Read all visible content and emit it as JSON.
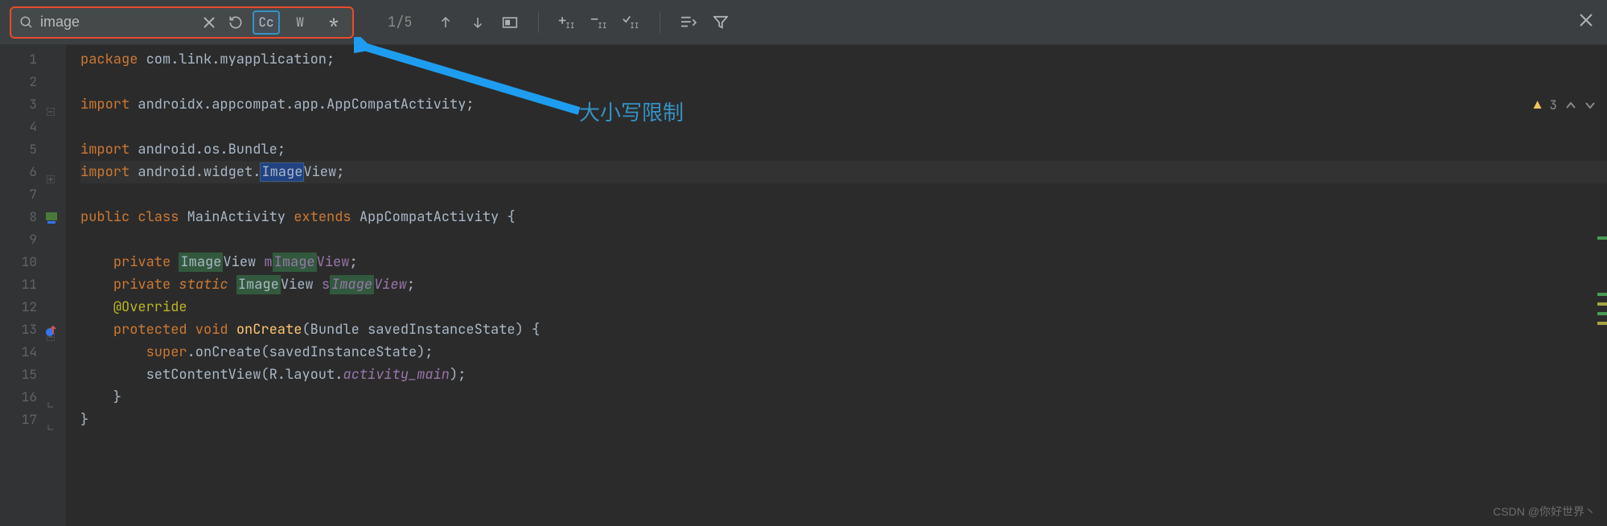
{
  "search": {
    "value": "image",
    "match_case_label": "Cc",
    "words_label": "W",
    "regex_char": "*",
    "result_count": "1/5"
  },
  "status": {
    "warning_count": "3"
  },
  "annotation": {
    "label": "大小写限制"
  },
  "watermark": "CSDN @你好世界丶",
  "code": {
    "lines": [
      {
        "n": "1",
        "tokens": [
          [
            "kw",
            "package "
          ],
          [
            "type",
            "com.link.myapplication"
          ],
          [
            "type",
            ";"
          ]
        ]
      },
      {
        "n": "2",
        "tokens": []
      },
      {
        "n": "3",
        "tokens": [
          [
            "kw",
            "import "
          ],
          [
            "type",
            "androidx.appcompat.app.AppCompatActivity"
          ],
          [
            "type",
            ";"
          ]
        ],
        "fold": "minus"
      },
      {
        "n": "4",
        "tokens": []
      },
      {
        "n": "5",
        "tokens": [
          [
            "kw",
            "import "
          ],
          [
            "type",
            "android.os.Bundle"
          ],
          [
            "type",
            ";"
          ]
        ]
      },
      {
        "n": "6",
        "tokens": [
          [
            "kw",
            "import "
          ],
          [
            "type",
            "android.widget."
          ],
          [
            "hlcur",
            "Image"
          ],
          [
            "type",
            "View"
          ],
          [
            "type",
            ";"
          ]
        ],
        "fold": "plus",
        "current": true
      },
      {
        "n": "7",
        "tokens": []
      },
      {
        "n": "8",
        "tokens": [
          [
            "kw",
            "public class "
          ],
          [
            "type",
            "MainActivity "
          ],
          [
            "kw",
            "extends "
          ],
          [
            "type",
            "AppCompatActivity {"
          ]
        ],
        "marker": "class"
      },
      {
        "n": "9",
        "tokens": []
      },
      {
        "n": "10",
        "tokens": [
          [
            "type",
            "    "
          ],
          [
            "kw",
            "private "
          ],
          [
            "hl",
            "Image"
          ],
          [
            "type",
            "View "
          ],
          [
            "field",
            "m"
          ],
          [
            "hlf",
            "Image"
          ],
          [
            "field",
            "View"
          ],
          [
            "type",
            ";"
          ]
        ]
      },
      {
        "n": "11",
        "tokens": [
          [
            "type",
            "    "
          ],
          [
            "kw",
            "private "
          ],
          [
            "kws",
            "static"
          ],
          [
            "type",
            " "
          ],
          [
            "hl",
            "Image"
          ],
          [
            "type",
            "View "
          ],
          [
            "field",
            "s"
          ],
          [
            "hlfi",
            "Image"
          ],
          [
            "fieldI",
            "View"
          ],
          [
            "type",
            ";"
          ]
        ]
      },
      {
        "n": "12",
        "tokens": [
          [
            "type",
            "    "
          ],
          [
            "note",
            "@Override"
          ]
        ]
      },
      {
        "n": "13",
        "tokens": [
          [
            "type",
            "    "
          ],
          [
            "kw",
            "protected void "
          ],
          [
            "fn",
            "onCreate"
          ],
          [
            "type",
            "(Bundle savedInstanceState) {"
          ]
        ],
        "fold": "minus",
        "marker": "override"
      },
      {
        "n": "14",
        "tokens": [
          [
            "type",
            "        "
          ],
          [
            "kw",
            "super"
          ],
          [
            "type",
            ".onCreate(savedInstanceState);"
          ]
        ]
      },
      {
        "n": "15",
        "tokens": [
          [
            "type",
            "        setContentView(R.layout."
          ],
          [
            "prop",
            "activity_main"
          ],
          [
            "type",
            ");"
          ]
        ]
      },
      {
        "n": "16",
        "tokens": [
          [
            "type",
            "    }"
          ]
        ],
        "fold": "end"
      },
      {
        "n": "17",
        "tokens": [
          [
            "type",
            "}"
          ]
        ],
        "fold": "end"
      }
    ]
  }
}
